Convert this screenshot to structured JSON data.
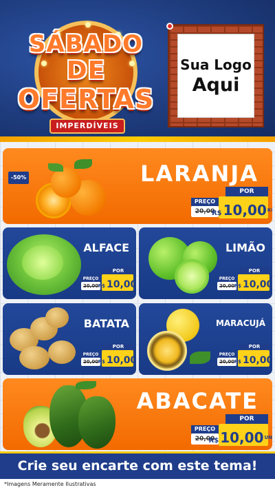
{
  "header": {
    "title_line1": "SÁBADO",
    "title_line2": "DE",
    "title_line3": "OFERTAS",
    "ribbon": "IMPERDÍVEIS",
    "logo_line1": "Sua Logo",
    "logo_line2": "Aqui"
  },
  "products": {
    "laranja": {
      "name": "LARANJA",
      "discount": "-50%",
      "preco": "PREÇO",
      "old": "20,00",
      "por": "POR",
      "currency": "R$",
      "value": "10,00",
      "unit": "KG"
    },
    "alface": {
      "name": "ALFACE",
      "preco": "PREÇO",
      "old": "20,00",
      "por": "POR",
      "currency": "R$",
      "value": "10,00"
    },
    "limao": {
      "name": "LIMÃO",
      "preco": "PREÇO",
      "old": "20,00",
      "por": "POR",
      "currency": "R$",
      "value": "10,00"
    },
    "batata": {
      "name": "BATATA",
      "preco": "PREÇO",
      "old": "20,00",
      "por": "POR",
      "currency": "R$",
      "value": "10,00"
    },
    "maracuja": {
      "name": "MARACUJÁ",
      "preco": "PREÇO",
      "old": "20,00",
      "por": "POR",
      "currency": "R$",
      "value": "10,00"
    },
    "abacate": {
      "name": "ABACATE",
      "preco": "PREÇO",
      "old": "20,00",
      "por": "POR",
      "currency": "R$",
      "value": "10,00",
      "unit": "UNID"
    }
  },
  "footer": {
    "cta": "Crie seu encarte com este tema!",
    "note": "*Imagens Meramente Ilustrativas"
  },
  "colors": {
    "navy": "#1f3d8a",
    "orange": "#f26a00",
    "yellow": "#ffd21a"
  }
}
